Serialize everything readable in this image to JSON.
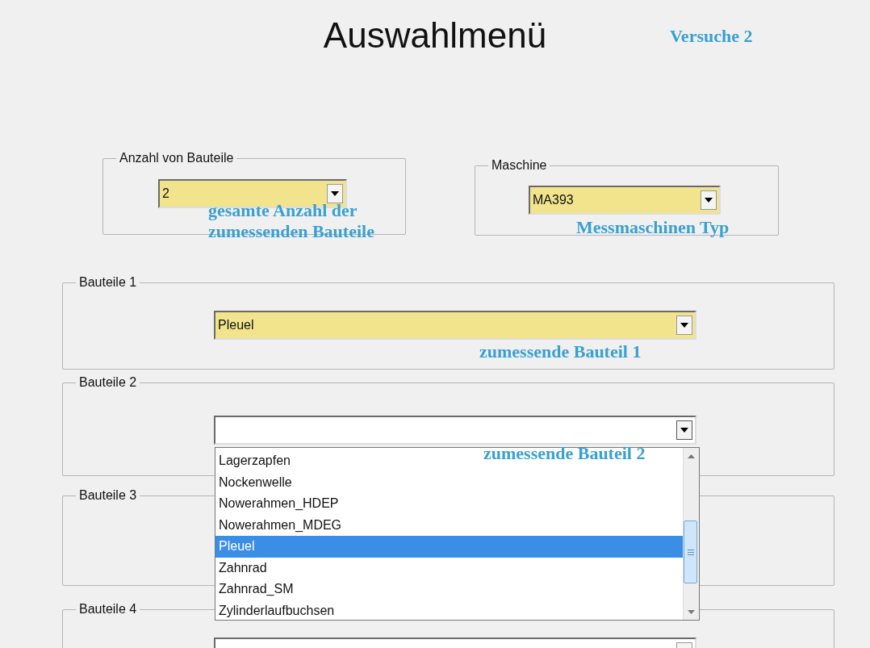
{
  "title": "Auswahlmenü",
  "note": "Versuche 2",
  "top_groups": [
    {
      "label": "Anzahl von Bauteile",
      "combo": {
        "value": "2",
        "highlighted": true
      },
      "annotation": "gesamte Anzahl der\nzumessenden Bauteile"
    },
    {
      "label": "Maschine",
      "combo": {
        "value": "MA393",
        "highlighted": true
      },
      "annotation": "Messmaschinen Typ"
    }
  ],
  "part_groups": [
    {
      "label": "Bauteile 1",
      "combo": {
        "value": "Pleuel",
        "highlighted": true
      },
      "annotation": "zumessende Bauteil 1"
    },
    {
      "label": "Bauteile 2",
      "combo": {
        "highlighted": false,
        "expanded": true
      },
      "annotation": "zumessende Bauteil 2",
      "options": [
        {
          "label": "Lagerzapfen",
          "selected": false
        },
        {
          "label": "Nockenwelle",
          "selected": false
        },
        {
          "label": "Nowerahmen_HDEP",
          "selected": false
        },
        {
          "label": "Nowerahmen_MDEG",
          "selected": false
        },
        {
          "label": "Pleuel",
          "selected": true
        },
        {
          "label": "Zahnrad",
          "selected": false
        },
        {
          "label": "Zahnrad_SM",
          "selected": false
        },
        {
          "label": "Zylinderlaufbuchsen",
          "selected": false
        }
      ]
    },
    {
      "label": "Bauteile 3"
    },
    {
      "label": "Bauteile 4",
      "combo": {
        "highlighted": false
      }
    }
  ]
}
